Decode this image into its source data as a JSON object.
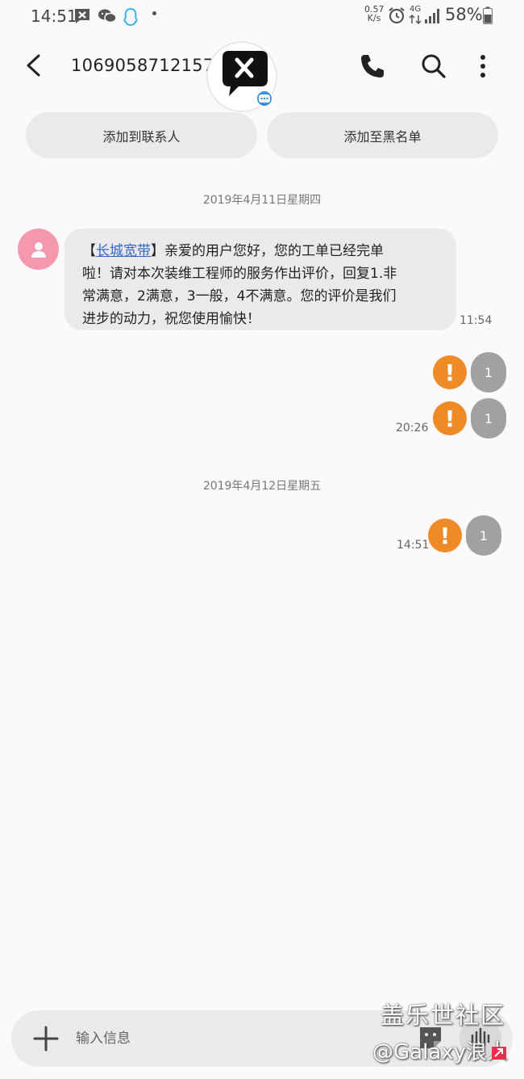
{
  "status_bar": {
    "time": "14:51",
    "net_speed_top": "0.57",
    "net_speed_bottom": "K/s",
    "network": "4G",
    "battery": "58%",
    "notif_icons": [
      "sms-blocked-icon",
      "wechat-icon",
      "qq-icon",
      "dot-icon"
    ],
    "right_icons": [
      "alarm-icon",
      "signal-icon",
      "battery-icon"
    ]
  },
  "header": {
    "phone_number": "10690587121577860",
    "icons": [
      "back-arrow-icon",
      "phone-icon",
      "search-icon",
      "more-vert-icon"
    ]
  },
  "actions": {
    "add_contact": "添加到联系人",
    "add_blacklist": "添加至黑名单"
  },
  "conversation": {
    "date_1": "2019年4月11日星期四",
    "incoming": {
      "bracket_open": "【",
      "link_text": "长城宽带",
      "bracket_close": "】",
      "line1": "亲爱的用户您好，您的工单已经完单",
      "line2": "啦！请对本次装维工程师的服务作出评价，回复1.非",
      "line3": "常满意，2满意，3一般，4不满意。您的评价是我们",
      "line4": "进步的动力，祝您使用愉快！",
      "time": "11:54"
    },
    "outgoing_1": {
      "text": "1",
      "fail_mark": "!"
    },
    "outgoing_2": {
      "text": "1",
      "fail_mark": "!",
      "time": "20:26"
    },
    "date_2": "2019年4月12日星期五",
    "outgoing_3": {
      "text": "1",
      "fail_mark": "!",
      "time": "14:51"
    }
  },
  "input": {
    "placeholder": "输入信息"
  },
  "watermark": {
    "line1": "盖乐世社区",
    "line2": "@Galaxy浪人"
  },
  "colors": {
    "background": "#fbf9fc",
    "bubble": "#ebe9ec",
    "fail": "#ef8b27",
    "outgoing": "#a1a1a1",
    "avatar": "#f598ad",
    "link": "#2f67c4"
  }
}
